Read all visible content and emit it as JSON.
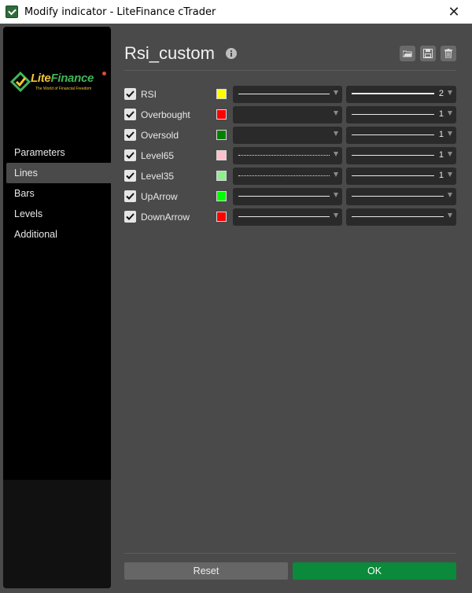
{
  "window": {
    "title": "Modify indicator - LiteFinance cTrader",
    "close_label": "✕"
  },
  "brand": {
    "name_part1": "Lite",
    "name_part2": "Finance",
    "tagline": "The World of Financial Freedom"
  },
  "sidebar": {
    "items": [
      {
        "label": "Parameters",
        "active": false
      },
      {
        "label": "Lines",
        "active": true
      },
      {
        "label": "Bars",
        "active": false
      },
      {
        "label": "Levels",
        "active": false
      },
      {
        "label": "Additional",
        "active": false
      }
    ]
  },
  "header": {
    "title": "Rsi_custom",
    "icons": [
      "info-icon",
      "folder-open-icon",
      "save-icon",
      "trash-icon"
    ]
  },
  "lines": [
    {
      "name": "RSI",
      "checked": true,
      "color": "#ffff00",
      "style": "solid",
      "width": "2"
    },
    {
      "name": "Overbought",
      "checked": true,
      "color": "#ff0000",
      "style": "dash-dot",
      "width": "1"
    },
    {
      "name": "Oversold",
      "checked": true,
      "color": "#008000",
      "style": "dash-dot",
      "width": "1"
    },
    {
      "name": "Level65",
      "checked": true,
      "color": "#ffc0cb",
      "style": "dotted",
      "width": "1"
    },
    {
      "name": "Level35",
      "checked": true,
      "color": "#90ee90",
      "style": "dotted",
      "width": "1"
    },
    {
      "name": "UpArrow",
      "checked": true,
      "color": "#00ff00",
      "style": "solid",
      "width": ""
    },
    {
      "name": "DownArrow",
      "checked": true,
      "color": "#ff0000",
      "style": "solid",
      "width": ""
    }
  ],
  "buttons": {
    "reset": "Reset",
    "ok": "OK"
  }
}
